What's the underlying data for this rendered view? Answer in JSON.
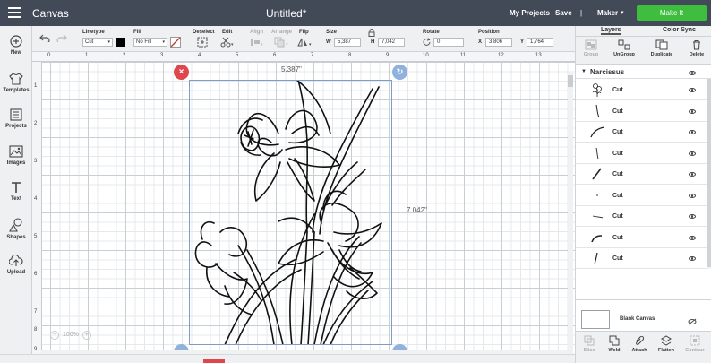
{
  "topbar": {
    "app_title": "Canvas",
    "doc_title": "Untitled*",
    "my_projects": "My Projects",
    "save": "Save",
    "separator": "|",
    "machine": "Maker",
    "make_it": "Make It"
  },
  "toolbar": {
    "undo_icon": "undo-icon",
    "redo_icon": "redo-icon",
    "linetype_label": "Linetype",
    "linetype_value": "Cut",
    "fill_label": "Fill",
    "fill_value": "No Fill",
    "deselect_label": "Deselect",
    "edit_label": "Edit",
    "align_label": "Align",
    "arrange_label": "Arrange",
    "flip_label": "Flip",
    "size_label": "Size",
    "size_w_label": "W",
    "size_w_value": "5,387",
    "size_h_label": "H",
    "size_h_value": "7,042",
    "rotate_label": "Rotate",
    "rotate_value": "0",
    "position_label": "Position",
    "pos_x_label": "X",
    "pos_x_value": "3,806",
    "pos_y_label": "Y",
    "pos_y_value": "1,764",
    "swatch_color": "#000000",
    "fill_icon_color": "#c0392b"
  },
  "leftbar": {
    "items": [
      {
        "label": "New",
        "icon": "plus-circle-icon"
      },
      {
        "label": "Templates",
        "icon": "shirt-icon"
      },
      {
        "label": "Projects",
        "icon": "projects-icon"
      },
      {
        "label": "Images",
        "icon": "image-icon"
      },
      {
        "label": "Text",
        "icon": "text-icon"
      },
      {
        "label": "Shapes",
        "icon": "shapes-icon"
      },
      {
        "label": "Upload",
        "icon": "upload-icon"
      }
    ]
  },
  "canvas": {
    "ruler_top": [
      "0",
      "1",
      "2",
      "3",
      "4",
      "5",
      "6",
      "7",
      "8",
      "9",
      "10",
      "11",
      "12",
      "13"
    ],
    "ruler_left": [
      "1",
      "2",
      "3",
      "4",
      "5",
      "6",
      "7",
      "8",
      "9"
    ],
    "width_dim": "5.387\"",
    "height_dim": "7.042\"",
    "zoom": "100%",
    "close_color": "#e0474c",
    "handle_color": "#8fb1dc"
  },
  "rightpanel": {
    "tabs": [
      "Layers",
      "Color Sync"
    ],
    "actions": [
      {
        "label": "Group",
        "enabled": false
      },
      {
        "label": "UnGroup",
        "enabled": true
      },
      {
        "label": "Duplicate",
        "enabled": true
      },
      {
        "label": "Delete",
        "enabled": true
      }
    ],
    "group_name": "Narcissus",
    "layers": [
      {
        "label": "Cut",
        "thumb": "flower-thumb"
      },
      {
        "label": "Cut",
        "thumb": "stroke-thumb"
      },
      {
        "label": "Cut",
        "thumb": "curve-thumb"
      },
      {
        "label": "Cut",
        "thumb": "stroke-thumb"
      },
      {
        "label": "Cut",
        "thumb": "stroke-thumb"
      },
      {
        "label": "Cut",
        "thumb": "dot-thumb"
      },
      {
        "label": "Cut",
        "thumb": "dash-thumb"
      },
      {
        "label": "Cut",
        "thumb": "curve-thumb"
      },
      {
        "label": "Cut",
        "thumb": "stroke-thumb"
      }
    ],
    "blank_canvas": "Blank Canvas",
    "bottom_actions": [
      {
        "label": "Slice",
        "enabled": false
      },
      {
        "label": "Weld",
        "enabled": true
      },
      {
        "label": "Attach",
        "enabled": true
      },
      {
        "label": "Flatten",
        "enabled": true
      },
      {
        "label": "Contour",
        "enabled": false
      }
    ]
  }
}
